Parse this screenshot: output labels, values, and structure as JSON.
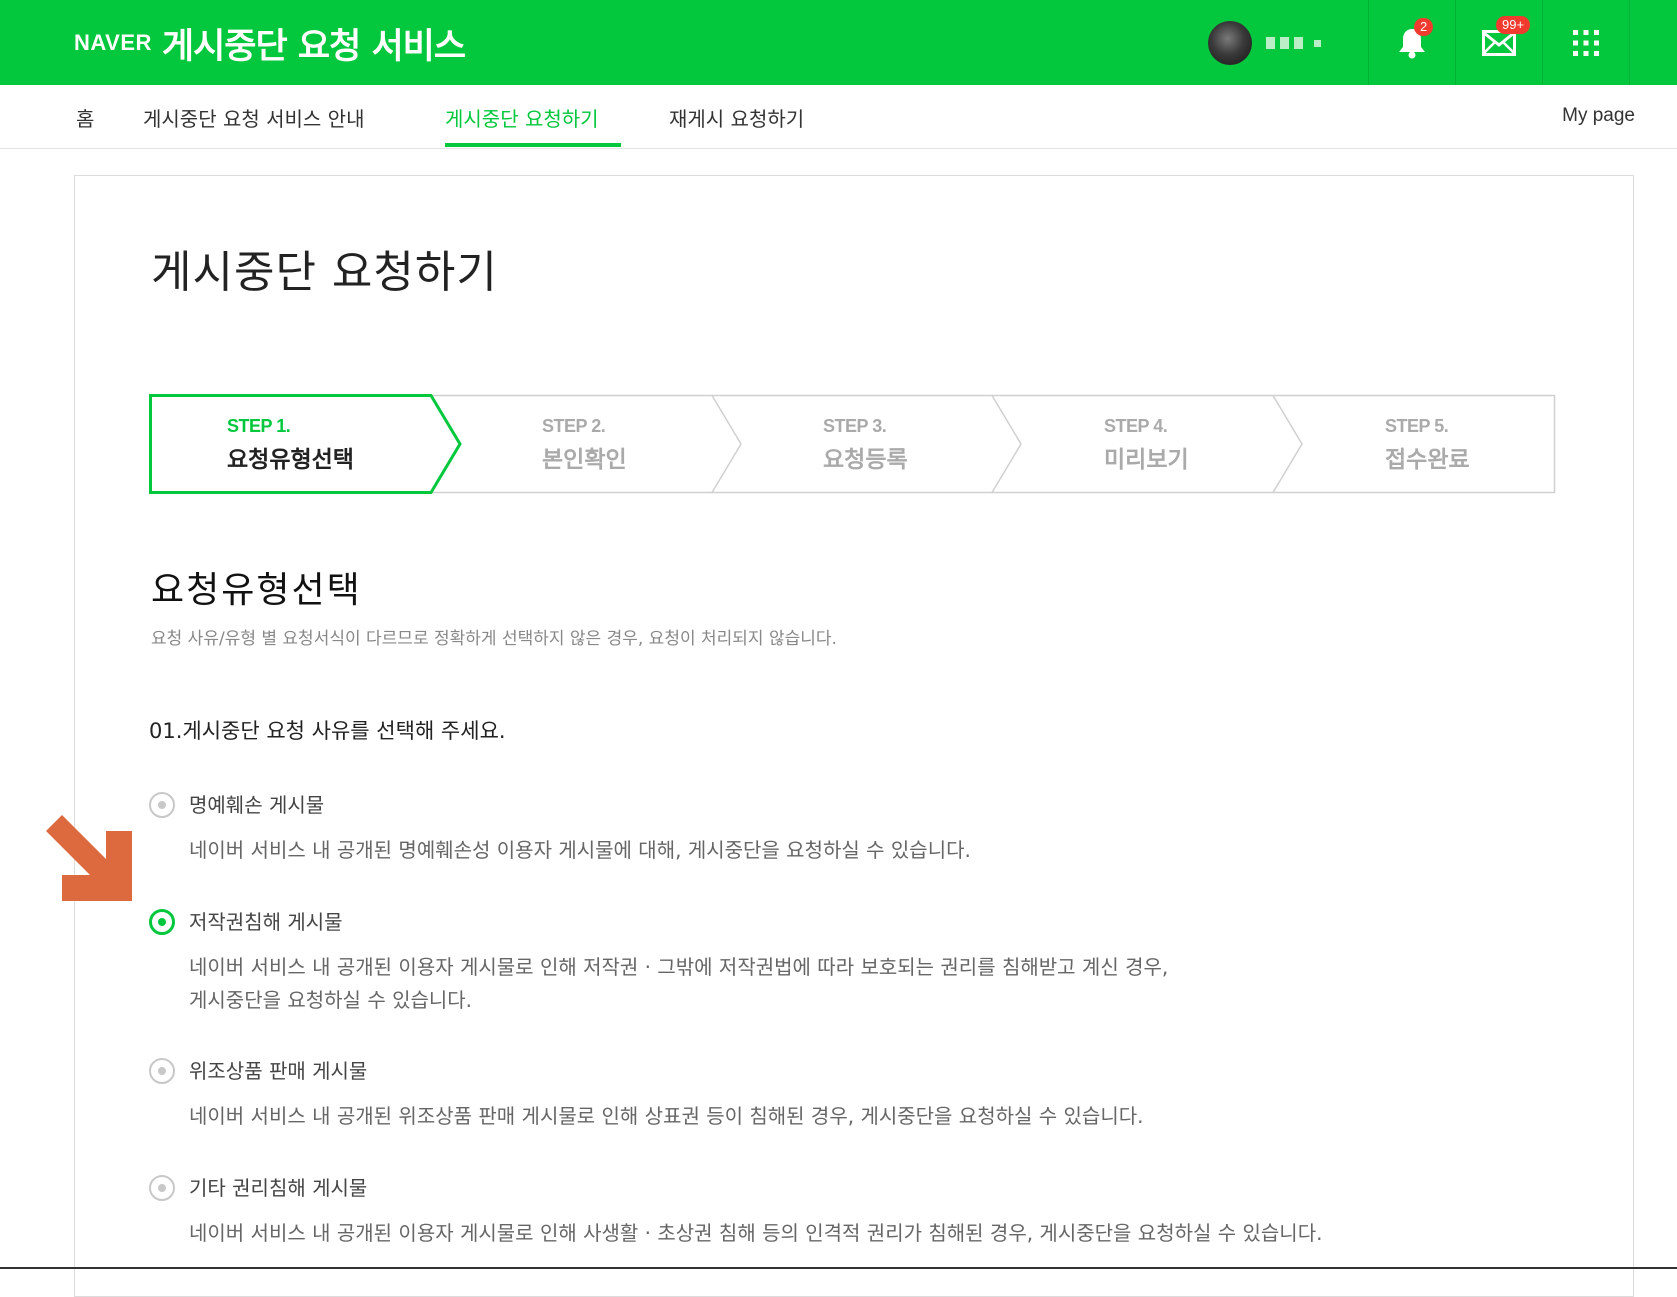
{
  "header": {
    "logo": "NAVER",
    "service_title": "게시중단 요청 서비스",
    "notification_count": "2",
    "mail_count": "99+"
  },
  "nav": {
    "items": [
      "홈",
      "게시중단 요청 서비스 안내",
      "게시중단 요청하기",
      "재게시 요청하기"
    ],
    "active_index": 2,
    "mypage": "My page"
  },
  "page": {
    "title": "게시중단 요청하기"
  },
  "steps": [
    {
      "num": "STEP 1.",
      "label": "요청유형선택",
      "active": true
    },
    {
      "num": "STEP 2.",
      "label": "본인확인",
      "active": false
    },
    {
      "num": "STEP 3.",
      "label": "요청등록",
      "active": false
    },
    {
      "num": "STEP 4.",
      "label": "미리보기",
      "active": false
    },
    {
      "num": "STEP 5.",
      "label": "접수완료",
      "active": false
    }
  ],
  "section": {
    "title": "요청유형선택",
    "description": "요청 사유/유형 별 요청서식이 다르므로 정확하게 선택하지 않은 경우, 요청이 처리되지 않습니다.",
    "question": "01.게시중단 요청 사유를 선택해 주세요."
  },
  "options": [
    {
      "label": "명예훼손 게시물",
      "desc_lines": [
        "네이버 서비스 내 공개된 명예훼손성 이용자 게시물에 대해, 게시중단을 요청하실 수 있습니다."
      ],
      "checked": false
    },
    {
      "label": "저작권침해 게시물",
      "desc_lines": [
        "네이버 서비스 내 공개된 이용자 게시물로 인해 저작권 · 그밖에 저작권법에 따라 보호되는 권리를 침해받고 계신 경우,",
        "게시중단을 요청하실 수 있습니다."
      ],
      "checked": true
    },
    {
      "label": "위조상품 판매 게시물",
      "desc_lines": [
        "네이버 서비스 내 공개된 위조상품 판매 게시물로 인해 상표권 등이 침해된 경우, 게시중단을 요청하실 수 있습니다."
      ],
      "checked": false
    },
    {
      "label": "기타 권리침해 게시물",
      "desc_lines": [
        "네이버 서비스 내 공개된 이용자 게시물로 인해 사생활 · 초상권 침해 등의 인격적 권리가 침해된 경우, 게시중단을 요청하실 수 있습니다."
      ],
      "checked": false
    }
  ],
  "colors": {
    "brand_green": "#03c73c",
    "badge_red": "#f03b2e",
    "annotation_arrow": "#dd6a3f"
  },
  "icons": {
    "notification": "bell-icon",
    "mail": "envelope-icon",
    "apps": "grid-icon",
    "annotation": "arrow-down-right-icon"
  }
}
